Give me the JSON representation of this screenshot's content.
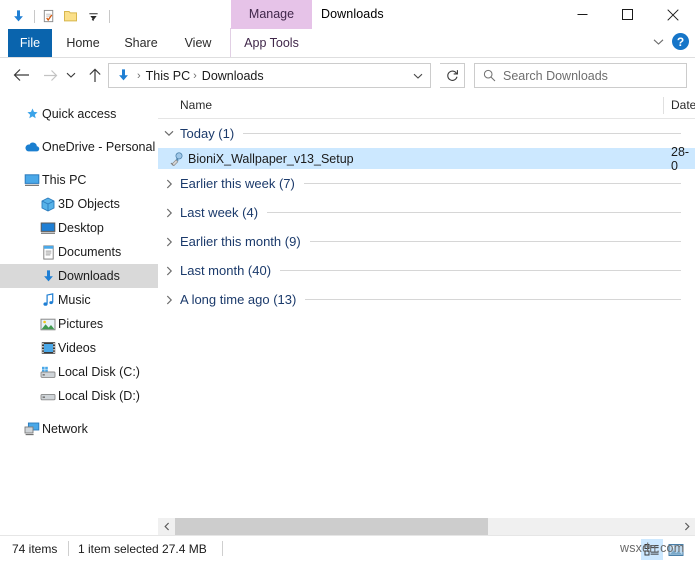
{
  "window": {
    "title": "Downloads",
    "contextual_tab": "Manage",
    "minimize_icon": "minimize-icon",
    "maximize_icon": "maximize-icon",
    "close_icon": "close-icon"
  },
  "quick_access_toolbar": {
    "items": [
      {
        "icon": "downloads-arrow-icon"
      },
      {
        "icon": "properties-icon"
      },
      {
        "icon": "new-folder-icon"
      },
      {
        "icon": "customize-chevron-icon"
      }
    ]
  },
  "ribbon": {
    "tabs": [
      {
        "label": "File",
        "id": "file"
      },
      {
        "label": "Home",
        "id": "home"
      },
      {
        "label": "Share",
        "id": "share"
      },
      {
        "label": "View",
        "id": "view"
      },
      {
        "label": "App Tools",
        "id": "apptools"
      }
    ],
    "collapse_icon": "chevron-down-icon",
    "help_label": "?"
  },
  "address": {
    "back_icon": "arrow-left-icon",
    "forward_icon": "arrow-right-icon",
    "recent_icon": "chevron-down-icon",
    "up_icon": "arrow-up-icon",
    "crumb_icon": "downloads-arrow-icon",
    "breadcrumbs": [
      "This PC",
      "Downloads"
    ],
    "separator": "›",
    "dropdown_icon": "chevron-down-icon",
    "refresh_icon": "refresh-icon"
  },
  "search": {
    "placeholder": "Search Downloads",
    "icon": "search-icon"
  },
  "navpane": {
    "items": [
      {
        "label": "Quick access",
        "icon": "star-pin-icon",
        "level": 0,
        "selected": false
      },
      {
        "label": "OneDrive - Personal",
        "icon": "cloud-icon",
        "level": 0,
        "selected": false
      },
      {
        "label": "This PC",
        "icon": "monitor-icon",
        "level": 0,
        "selected": false
      },
      {
        "label": "3D Objects",
        "icon": "cube-icon",
        "level": 1,
        "selected": false
      },
      {
        "label": "Desktop",
        "icon": "desktop-icon",
        "level": 1,
        "selected": false
      },
      {
        "label": "Documents",
        "icon": "document-icon",
        "level": 1,
        "selected": false
      },
      {
        "label": "Downloads",
        "icon": "downloads-arrow-icon",
        "level": 1,
        "selected": true
      },
      {
        "label": "Music",
        "icon": "music-note-icon",
        "level": 1,
        "selected": false
      },
      {
        "label": "Pictures",
        "icon": "picture-icon",
        "level": 1,
        "selected": false
      },
      {
        "label": "Videos",
        "icon": "video-icon",
        "level": 1,
        "selected": false
      },
      {
        "label": "Local Disk (C:)",
        "icon": "system-drive-icon",
        "level": 1,
        "selected": false
      },
      {
        "label": "Local Disk (D:)",
        "icon": "drive-icon",
        "level": 1,
        "selected": false
      },
      {
        "label": "Network",
        "icon": "network-icon",
        "level": 0,
        "selected": false
      }
    ]
  },
  "filelist": {
    "columns": [
      {
        "label": "Name",
        "id": "name"
      },
      {
        "label": "Date",
        "id": "date"
      }
    ],
    "groups": [
      {
        "label": "Today (1)",
        "expanded": true,
        "chevron": "chevron-down-icon",
        "files": [
          {
            "name": "BioniX_Wallpaper_v13_Setup",
            "date": "28-0",
            "icon": "setup-exe-icon",
            "selected": true
          }
        ]
      },
      {
        "label": "Earlier this week (7)",
        "expanded": false,
        "chevron": "chevron-right-icon",
        "files": []
      },
      {
        "label": "Last week (4)",
        "expanded": false,
        "chevron": "chevron-right-icon",
        "files": []
      },
      {
        "label": "Earlier this month (9)",
        "expanded": false,
        "chevron": "chevron-right-icon",
        "files": []
      },
      {
        "label": "Last month (40)",
        "expanded": false,
        "chevron": "chevron-right-icon",
        "files": []
      },
      {
        "label": "A long time ago (13)",
        "expanded": false,
        "chevron": "chevron-right-icon",
        "files": []
      }
    ]
  },
  "scrollbar": {
    "left_icon": "chevron-left-icon",
    "right_icon": "chevron-right-icon"
  },
  "statusbar": {
    "item_count": "74 items",
    "selection": "1 item selected  27.4 MB",
    "view_details_icon": "details-view-icon",
    "view_large_icons_icon": "large-icons-view-icon"
  },
  "watermark": {
    "text": "wsxdn.com"
  },
  "colors": {
    "accent_blue": "#0a64ad",
    "selection_blue": "#cce8ff",
    "contextual_purple": "#e6c3e8",
    "nav_selection_gray": "#d9d9d9",
    "group_header_text": "#1b3a6b",
    "help_blue": "#1675c8"
  }
}
